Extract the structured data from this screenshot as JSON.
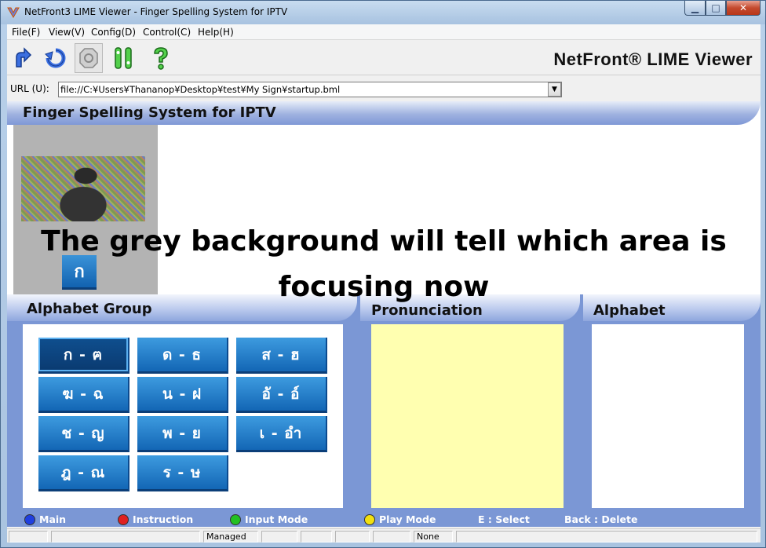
{
  "window": {
    "title": "NetFront3 LIME Viewer - Finger Spelling System for IPTV"
  },
  "menu": [
    "File(F)",
    "View(V)",
    "Config(D)",
    "Control(C)",
    "Help(H)"
  ],
  "toolbar": {
    "brand": "NetFront® LIME Viewer",
    "icons": [
      "up-arrow-icon",
      "back-icon",
      "stop-icon",
      "settings-icon",
      "help-icon"
    ]
  },
  "url": {
    "label": "URL (U):",
    "value": "file://C:¥Users¥Thananop¥Desktop¥test¥My Sign¥startup.bml"
  },
  "page": {
    "header_title": "Finger Spelling System for IPTV",
    "selected_char": "ก",
    "overlay_text_line1": "The grey background will tell which area  is",
    "overlay_text_line2": "focusing now",
    "sections": {
      "alphabet_group": "Alphabet Group",
      "pronunciation": "Pronunciation",
      "alphabet": "Alphabet"
    },
    "groups": [
      [
        "ก - ฅ",
        "ด - ธ",
        "ส - ฮ"
      ],
      [
        "ฆ - ฉ",
        "น - ฝ",
        "อั - อ์"
      ],
      [
        "ช - ญ",
        "พ - ย",
        "เ - อำ"
      ],
      [
        "ฎ - ณ",
        "ร - ษ"
      ]
    ],
    "legend": {
      "main": "Main",
      "instruction": "Instruction",
      "input_mode": "Input Mode",
      "play_mode": "Play Mode",
      "select": "E : Select",
      "back": "Back : Delete"
    },
    "colors": {
      "blue": "#1f3fe0",
      "red": "#e02020",
      "green": "#22c022",
      "yellow": "#f2e010"
    }
  },
  "status": {
    "mode": "Managed",
    "security": "None"
  }
}
